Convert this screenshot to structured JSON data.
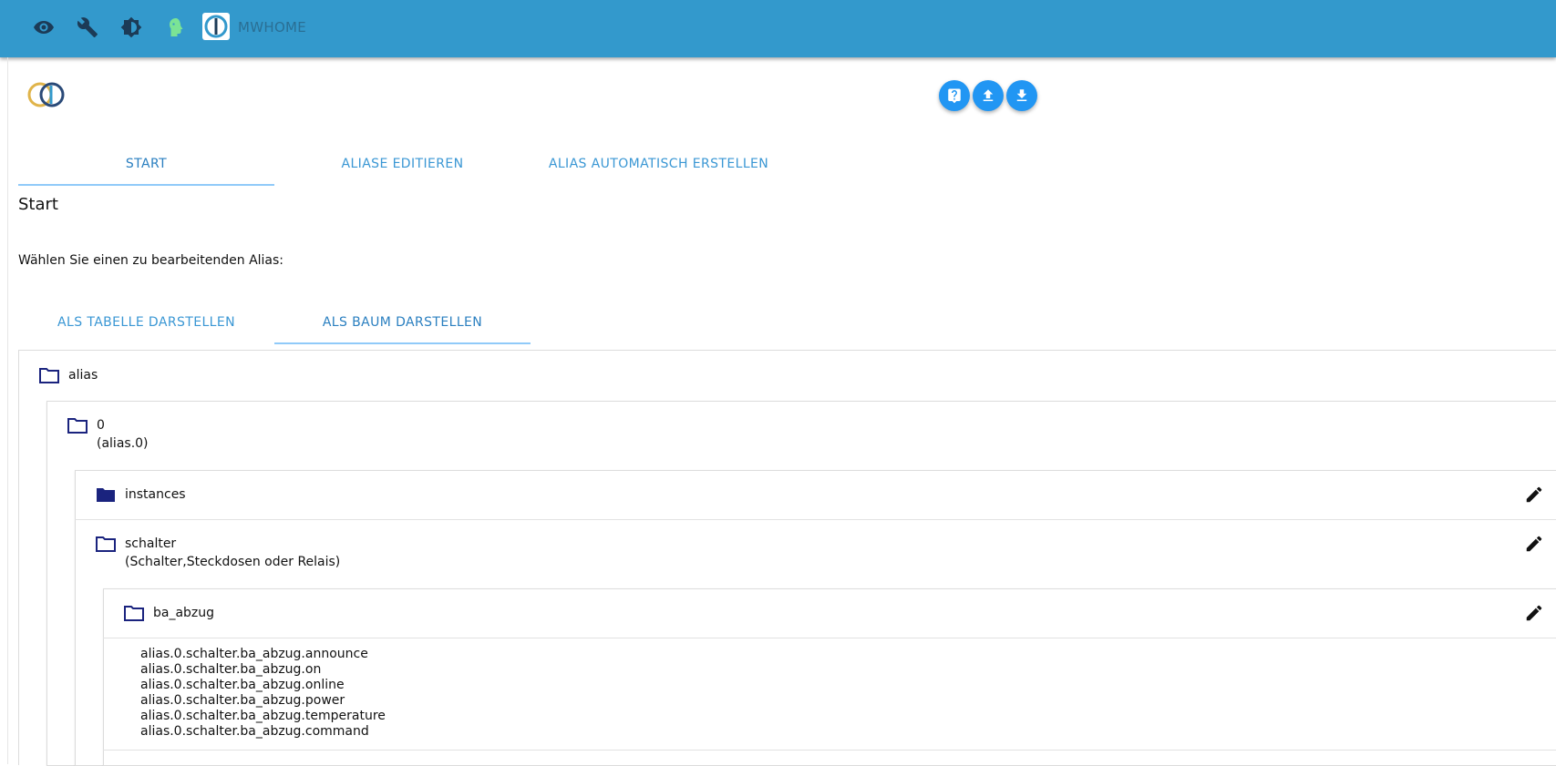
{
  "topbar": {
    "instance_title": "MWHOME",
    "icons": [
      "eye-icon",
      "wrench-icon",
      "brightness-icon",
      "expert-head-icon",
      "iobroker-logo-icon"
    ]
  },
  "toolbar": {
    "buttons": [
      "help-icon",
      "upload-icon",
      "download-icon"
    ]
  },
  "tabs": [
    "START",
    "ALIASE EDITIEREN",
    "ALIAS AUTOMATISCH ERSTELLEN"
  ],
  "section_title": "Start",
  "prompt": "Wählen Sie einen zu bearbeitenden Alias:",
  "view_tabs": [
    "ALS TABELLE DARSTELLEN",
    "ALS BAUM DARSTELLEN"
  ],
  "tree": {
    "root": {
      "label": "alias"
    },
    "level0": {
      "label": "0",
      "sub": "(alias.0)"
    },
    "instances": {
      "label": "instances"
    },
    "schalter": {
      "label": "schalter",
      "sub": "(Schalter,Steckdosen oder Relais)"
    },
    "ba_abzug": {
      "label": "ba_abzug",
      "states": [
        "alias.0.schalter.ba_abzug.announce",
        "alias.0.schalter.ba_abzug.on",
        "alias.0.schalter.ba_abzug.online",
        "alias.0.schalter.ba_abzug.power",
        "alias.0.schalter.ba_abzug.temperature",
        "alias.0.schalter.ba_abzug.command"
      ]
    }
  },
  "colors": {
    "topbar": "#3399cc",
    "accent": "#2196f3",
    "folder": "#1a237e",
    "tab_text": "#3a97d4"
  }
}
